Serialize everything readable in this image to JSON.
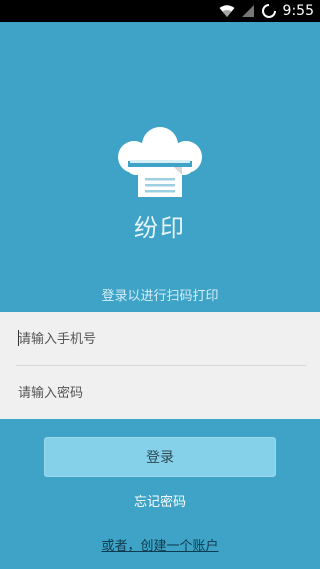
{
  "status_bar": {
    "time": "9:55",
    "icons": [
      "wifi-icon",
      "signal-icon",
      "battery-icon"
    ]
  },
  "app": {
    "name": "纷印",
    "logo_icon": "cloud-printer-icon",
    "subtitle": "登录以进行扫码打印"
  },
  "form": {
    "phone_placeholder": "请输入手机号",
    "phone_value": "",
    "password_placeholder": "请输入密码",
    "password_value": ""
  },
  "actions": {
    "login_label": "登录",
    "forgot_label": "忘记密码",
    "register_label": "或者，创建一个账户"
  },
  "colors": {
    "background": "#3ea3c6",
    "form_panel": "#f0f0f0",
    "login_button": "#85d1e9"
  }
}
